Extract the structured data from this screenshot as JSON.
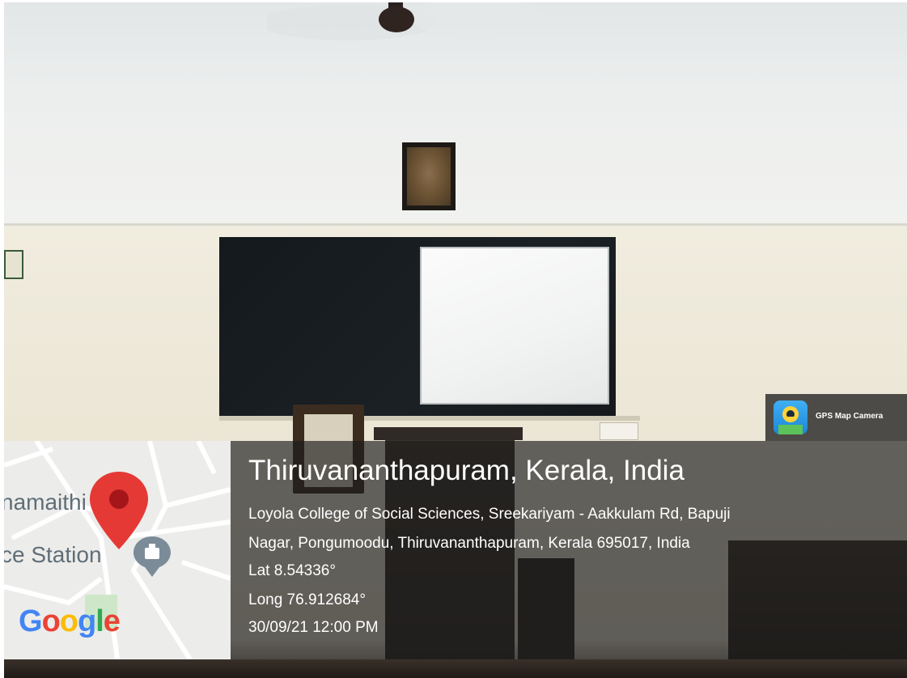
{
  "photo": {
    "description_colors": {
      "overlay": "#1c1c1c",
      "map_bg": "#ececea",
      "pin": "#e53935"
    }
  },
  "map": {
    "label_line1": "namaithi",
    "label_line2": "ce Station",
    "pin_icon": "map-pin-icon",
    "police_icon": "police-station-icon",
    "logo_letters": [
      {
        "char": "G",
        "color": "#4285F4"
      },
      {
        "char": "o",
        "color": "#EA4335"
      },
      {
        "char": "o",
        "color": "#FBBC05"
      },
      {
        "char": "g",
        "color": "#4285F4"
      },
      {
        "char": "l",
        "color": "#34A853"
      },
      {
        "char": "e",
        "color": "#EA4335"
      }
    ]
  },
  "badge": {
    "app_name": "GPS Map Camera",
    "icon": "gps-camera-app-icon"
  },
  "stamp": {
    "place": "Thiruvananthapuram, Kerala, India",
    "address_line1": "Loyola College of Social Sciences, Sreekariyam - Aakkulam Rd, Bapuji",
    "address_line2": "Nagar, Pongumoodu, Thiruvananthapuram, Kerala 695017, India",
    "lat": "Lat 8.54336°",
    "long": "Long 76.912684°",
    "datetime": "30/09/21 12:00 PM"
  }
}
